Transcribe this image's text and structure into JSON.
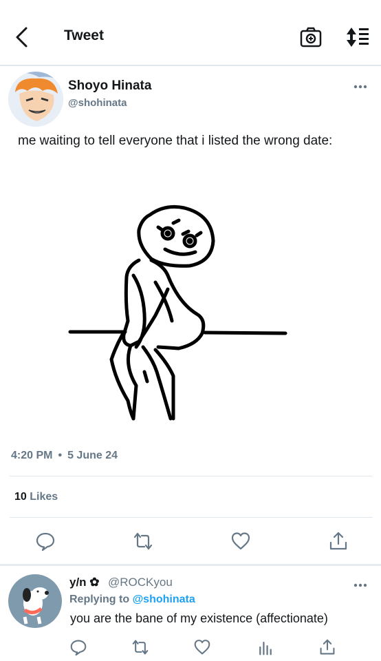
{
  "header": {
    "title": "Tweet"
  },
  "tweet": {
    "author_name": "Shoyo Hinata",
    "author_handle": "@shohinata",
    "text": "me waiting to tell everyone that i listed the wrong date:",
    "time": "4:20 PM",
    "date": "5 June 24",
    "likes_count": "10",
    "likes_label": "Likes"
  },
  "reply": {
    "author_name": "y/n ✿",
    "author_handle": "@ROCKyou",
    "replying_prefix": "Replying to",
    "replying_to": "@shohinata",
    "text": "you are the bane of my existence (affectionate)"
  },
  "icons": {
    "back": "chevron-left-icon",
    "camera": "camera-icon",
    "sort": "sort-icon",
    "more": "more-horizontal-icon",
    "reply": "comment-icon",
    "retweet": "retweet-icon",
    "like": "heart-icon",
    "share": "share-icon",
    "analytics": "analytics-icon"
  },
  "colors": {
    "accent": "#1da1f2",
    "muted": "#657786",
    "divider": "#e1e8ed"
  }
}
